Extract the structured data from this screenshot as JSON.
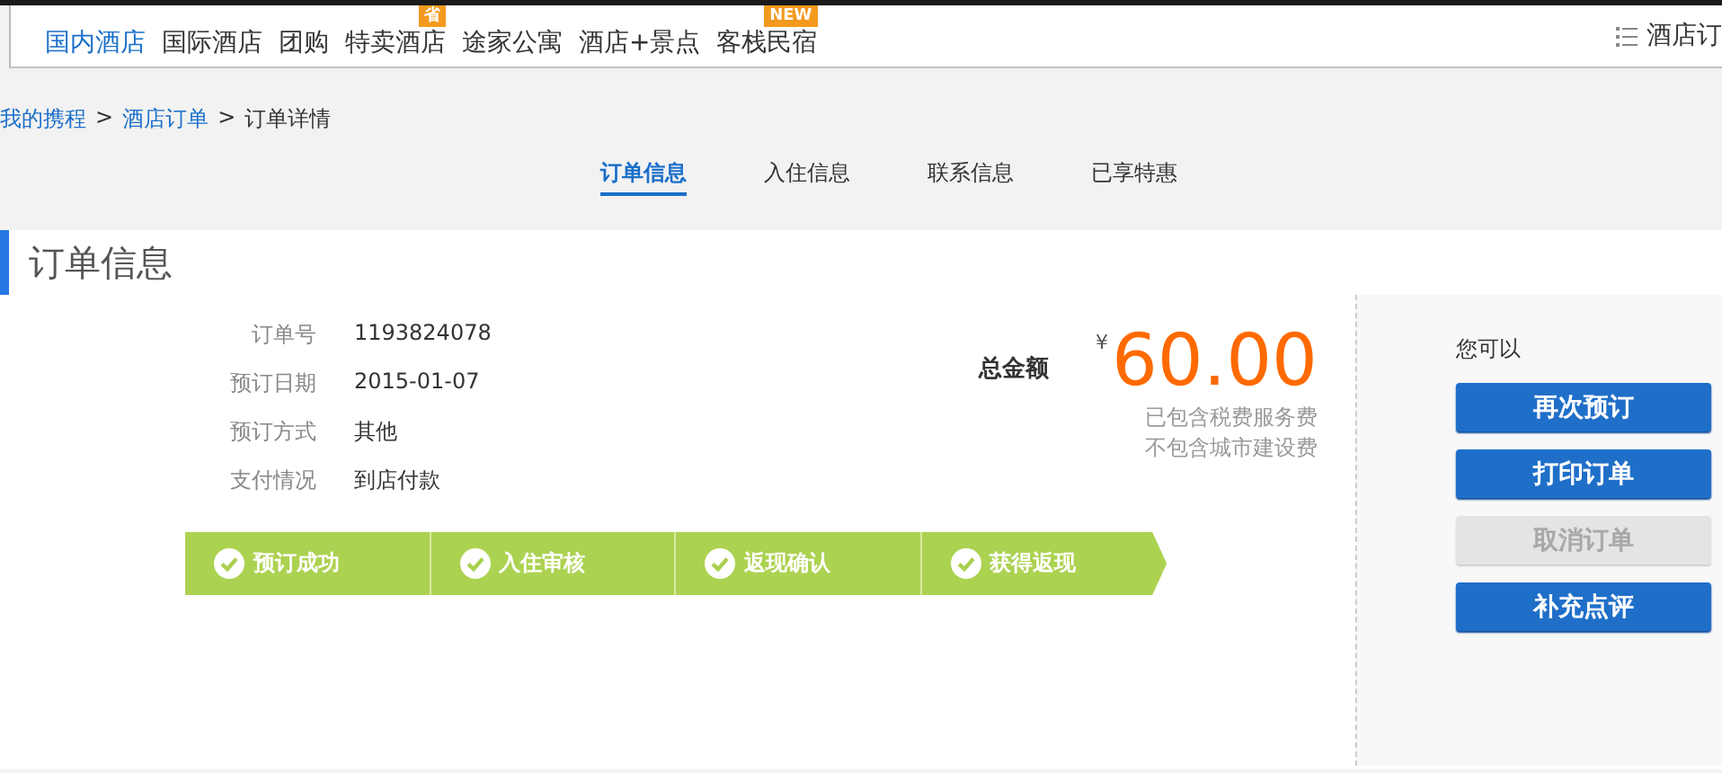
{
  "nav": {
    "items": [
      {
        "label": "国内酒店",
        "selected": true
      },
      {
        "label": "国际酒店",
        "selected": false
      },
      {
        "label": "团购",
        "selected": false
      },
      {
        "label": "特卖酒店",
        "selected": false,
        "badge": "省"
      },
      {
        "label": "途家公寓",
        "selected": false
      },
      {
        "label": "酒店+景点",
        "selected": false
      },
      {
        "label": "客栈民宿",
        "selected": false,
        "badge": "NEW"
      }
    ],
    "orders_link": "酒店订"
  },
  "breadcrumb": [
    {
      "label": "我的携程",
      "kind": "link"
    },
    {
      "label": ">",
      "kind": "sep"
    },
    {
      "label": "酒店订单",
      "kind": "link"
    },
    {
      "label": ">",
      "kind": "sep"
    },
    {
      "label": "订单详情",
      "kind": "current"
    }
  ],
  "tabs": [
    {
      "label": "订单信息",
      "selected": true
    },
    {
      "label": "入住信息",
      "selected": false
    },
    {
      "label": "联系信息",
      "selected": false
    },
    {
      "label": "已享特惠",
      "selected": false
    }
  ],
  "section_title": "订单信息",
  "details": [
    {
      "label": "订单号",
      "value": "1193824078"
    },
    {
      "label": "预订日期",
      "value": "2015-01-07"
    },
    {
      "label": "预订方式",
      "value": "其他"
    },
    {
      "label": "支付情况",
      "value": "到店付款"
    }
  ],
  "total": {
    "label": "总金额",
    "currency": "¥",
    "amount": "60.00",
    "notes": [
      "已包含税费服务费",
      "不包含城市建设费"
    ]
  },
  "steps": [
    {
      "label": "预订成功",
      "done": true
    },
    {
      "label": "入住审核",
      "done": true
    },
    {
      "label": "返现确认",
      "done": true
    },
    {
      "label": "获得返现",
      "done": true
    }
  ],
  "actions": {
    "title": "您可以",
    "buttons": [
      {
        "label": "再次预订",
        "disabled": false
      },
      {
        "label": "打印订单",
        "disabled": false
      },
      {
        "label": "取消订单",
        "disabled": true
      },
      {
        "label": "补充点评",
        "disabled": false
      }
    ]
  }
}
